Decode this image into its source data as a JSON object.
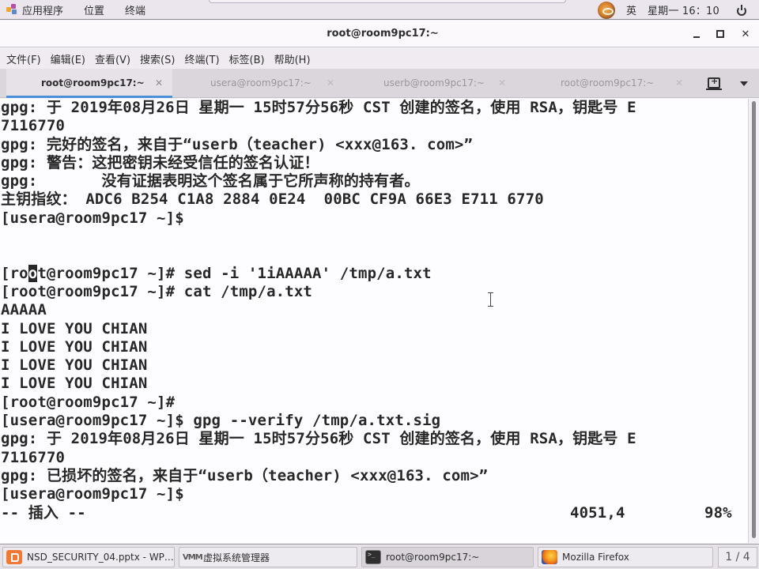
{
  "topbar": {
    "menus": [
      "应用程序",
      "位置",
      "终端"
    ],
    "ime": "英",
    "clock": "星期一 16：10"
  },
  "window": {
    "title": "root@room9pc17:~",
    "close_glyph": "✕"
  },
  "menubar": {
    "items": [
      "文件(F)",
      "编辑(E)",
      "查看(V)",
      "搜索(S)",
      "终端(T)",
      "标签(B)",
      "帮助(H)"
    ]
  },
  "tabs": [
    {
      "label": "root@room9pc17:~",
      "active": true,
      "close": "✕"
    },
    {
      "label": "usera@room9pc17:~",
      "active": false,
      "close": "✕"
    },
    {
      "label": "userb@room9pc17:~",
      "active": false,
      "close": "✕"
    },
    {
      "label": "root@room9pc17:~",
      "active": false,
      "close": "✕"
    }
  ],
  "terminal": {
    "lines": [
      "gpg: 于 2019年08月26日 星期一 15时57分56秒 CST 创建的签名，使用 RSA，钥匙号 E",
      "7116770",
      "gpg: 完好的签名，来自于“userb（teacher) <xxx@163. com>”",
      "gpg: 警告：这把密钥未经受信任的签名认证！",
      "gpg:       没有证据表明这个签名属于它所声称的持有者。",
      "主钥指纹： ADC6 B254 C1A8 2884 0E24  00BC CF9A 66E3 E711 6770",
      "[usera@room9pc17 ~]$",
      "",
      "",
      "[root@room9pc17 ~]# sed -i '1iAAAAA' /tmp/a.txt",
      "[root@room9pc17 ~]# cat /tmp/a.txt",
      "AAAAA",
      "I LOVE YOU CHIAN",
      "I LOVE YOU CHIAN",
      "I LOVE YOU CHIAN",
      "I LOVE YOU CHIAN",
      "[root@room9pc17 ~]#",
      "[usera@room9pc17 ~]$ gpg --verify /tmp/a.txt.sig",
      "gpg: 于 2019年08月26日 星期一 15时57分56秒 CST 创建的签名，使用 RSA，钥匙号 E",
      "7116770",
      "gpg: 已损坏的签名，来自于“userb（teacher) <xxx@163. com>”",
      "[usera@room9pc17 ~]$"
    ],
    "cursor_line": {
      "before": "[ro",
      "char": "o",
      "after": "t@room9pc17 ~]# sed -i '1iAAAAA' /tmp/a.txt"
    },
    "status": {
      "mode": "-- 插入 --",
      "position": "4051,4",
      "percent": "98%"
    }
  },
  "taskbar": {
    "items": [
      {
        "label": "NSD_SECURITY_04.pptx - WP…",
        "icon": "wps-presentation-icon"
      },
      {
        "label": "虚拟系统管理器",
        "icon": "virt-manager-icon",
        "icon_text": "VMM"
      },
      {
        "label": "root@room9pc17:~",
        "icon": "terminal-icon",
        "active": true
      },
      {
        "label": "Mozilla Firefox",
        "icon": "firefox-icon"
      }
    ],
    "workspace": "1 / 4"
  }
}
